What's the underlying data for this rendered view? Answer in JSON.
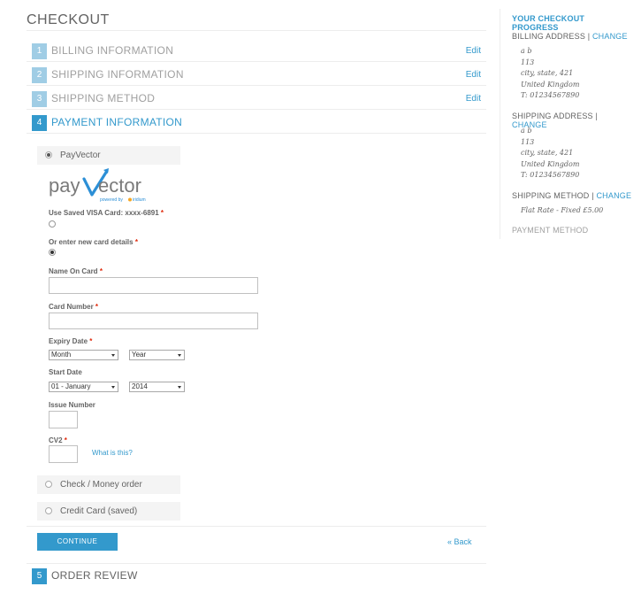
{
  "page": {
    "title": "CHECKOUT"
  },
  "steps": [
    {
      "num": "1",
      "label": "BILLING INFORMATION",
      "edit": "Edit"
    },
    {
      "num": "2",
      "label": "SHIPPING INFORMATION",
      "edit": "Edit"
    },
    {
      "num": "3",
      "label": "SHIPPING METHOD",
      "edit": "Edit"
    },
    {
      "num": "4",
      "label": "PAYMENT INFORMATION"
    },
    {
      "num": "5",
      "label": "ORDER REVIEW"
    }
  ],
  "payment": {
    "methods": [
      {
        "label": "PayVector",
        "selected": true
      },
      {
        "label": "Check / Money order",
        "selected": false
      },
      {
        "label": "Credit Card (saved)",
        "selected": false
      }
    ],
    "logo": {
      "text_pay": "pay",
      "text_vector": "ector",
      "tagline": "powered by",
      "brand": "iridium"
    },
    "saved_card_label": "Use Saved VISA Card: xxxx-6891",
    "new_card_label": "Or enter new card details",
    "required_mark": "*",
    "name_on_card_label": "Name On Card",
    "card_number_label": "Card Number",
    "expiry_label": "Expiry Date",
    "expiry_month": "Month",
    "expiry_year": "Year",
    "start_label": "Start Date",
    "start_month": "01 - January",
    "start_year": "2014",
    "issue_label": "Issue Number",
    "cv2_label": "CV2",
    "what_is_this": "What is this?"
  },
  "actions": {
    "continue": "CONTINUE",
    "back": "« Back"
  },
  "sidebar": {
    "title": "YOUR CHECKOUT PROGRESS",
    "change": "CHANGE",
    "separator": "|",
    "billing": {
      "heading": "BILLING ADDRESS",
      "lines": [
        "a b",
        "113",
        "city, state, 421",
        "United Kingdom",
        "T: 01234567890"
      ]
    },
    "shipping": {
      "heading": "SHIPPING ADDRESS",
      "lines": [
        "a b",
        "113",
        "city, state, 421",
        "United Kingdom",
        "T: 01234567890"
      ]
    },
    "shipping_method": {
      "heading": "SHIPPING METHOD",
      "value": "Flat Rate - Fixed £5.00"
    },
    "payment_method": {
      "heading": "PAYMENT METHOD"
    }
  }
}
